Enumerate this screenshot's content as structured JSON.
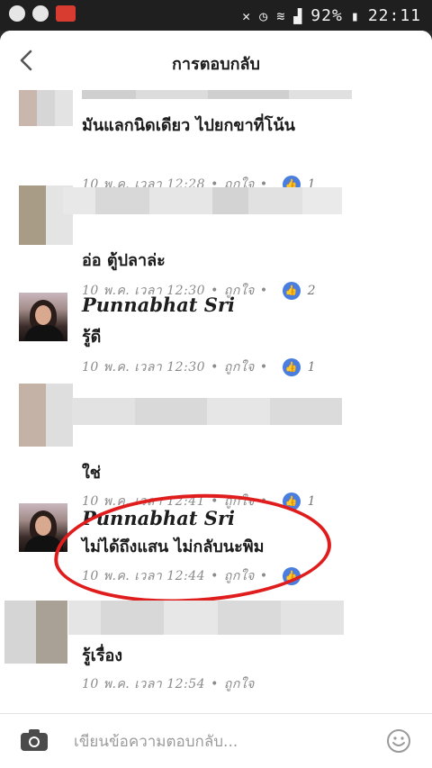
{
  "status_bar": {
    "battery": "92%",
    "time": "22:11"
  },
  "header": {
    "title": "การตอบกลับ"
  },
  "comments": [
    {
      "name": "",
      "text": "มันแลกนิดเดียว ไปยกขาที่โน้น",
      "time": "10 พ.ค. เวลา 12:28",
      "like_label": "ถูกใจ",
      "likes": "1"
    },
    {
      "name": "",
      "text": "อ่อ ตู้ปลาล่ะ",
      "time": "10 พ.ค. เวลา 12:30",
      "like_label": "ถูกใจ",
      "likes": "2"
    },
    {
      "name": "Punnabhat Sri",
      "text": "รู้ดี",
      "time": "10 พ.ค. เวลา 12:30",
      "like_label": "ถูกใจ",
      "likes": "1"
    },
    {
      "name": "",
      "text": "ใช่",
      "time": "10 พ.ค. เวลา 12:41",
      "like_label": "ถูกใจ",
      "likes": "1"
    },
    {
      "name": "Punnabhat Sri",
      "text": "ไม่ได้ถึงแสน ไม่กลับนะพิม",
      "time": "10 พ.ค. เวลา 12:44",
      "like_label": "ถูกใจ",
      "likes": ""
    },
    {
      "name": "",
      "text": "รู้เรื่อง",
      "time": "10 พ.ค. เวลา 12:54",
      "like_label": "ถูกใจ",
      "likes": ""
    }
  ],
  "composer": {
    "placeholder": "เขียนข้อความตอบกลับ..."
  },
  "colors": {
    "like_blue": "#4a7de0",
    "highlight_red": "#e01d1d"
  },
  "icons": {
    "back": "chevron-left-icon",
    "like": "thumbs-up-icon",
    "camera": "camera-icon",
    "emoji": "smiley-icon"
  }
}
